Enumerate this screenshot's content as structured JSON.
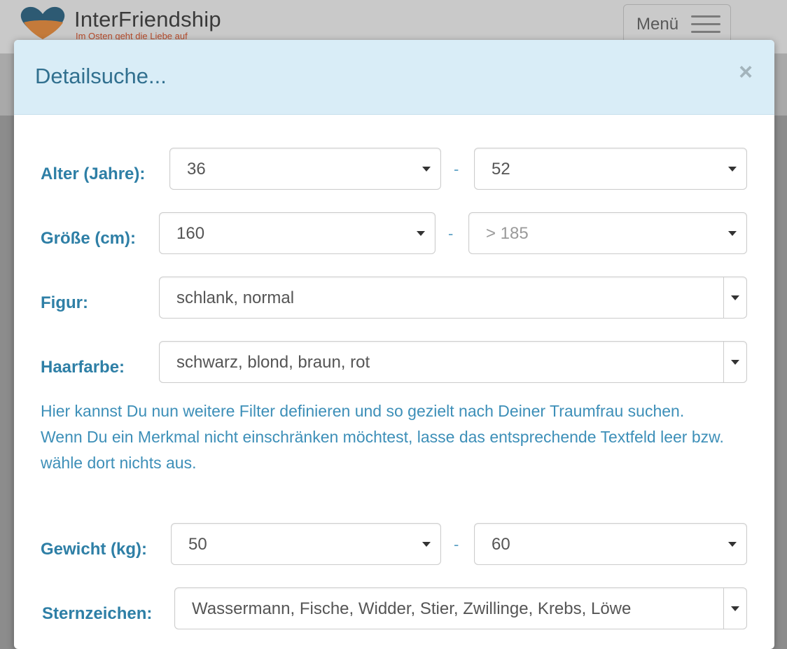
{
  "header": {
    "logo_title": "InterFriendship",
    "logo_subtitle": "Im Osten geht die Liebe auf",
    "menu_label": "Menü"
  },
  "modal": {
    "title": "Detailsuche...",
    "close_symbol": "×",
    "age": {
      "label": "Alter (Jahre):",
      "from": "36",
      "to": "52",
      "separator": "-"
    },
    "height": {
      "label": "Größe (cm):",
      "from": "160",
      "to": "> 185",
      "separator": "-"
    },
    "figure": {
      "label": "Figur:",
      "value": "schlank, normal"
    },
    "hair": {
      "label": "Haarfarbe:",
      "value": "schwarz, blond, braun, rot"
    },
    "info_line1": "Hier kannst Du nun weitere Filter definieren und so gezielt nach Deiner Traumfrau suchen.",
    "info_line2": "Wenn Du ein Merkmal nicht einschränken möchtest, lasse das entsprechende Textfeld leer bzw. wähle dort nichts aus.",
    "weight": {
      "label": "Gewicht (kg):",
      "from": "50",
      "to": "60",
      "separator": "-"
    },
    "zodiac": {
      "label": "Sternzeichen:",
      "value": "Wassermann, Fische, Widder, Stier, Zwillinge, Krebs, Löwe"
    }
  },
  "colors": {
    "header_bg": "#d9edf7",
    "title_color": "#31708f",
    "label_color": "#2e7fa6",
    "info_color": "#3d8fb8"
  },
  "icons": [
    "heart-logo-icon",
    "hamburger-icon",
    "close-icon",
    "caret-down-icon"
  ]
}
